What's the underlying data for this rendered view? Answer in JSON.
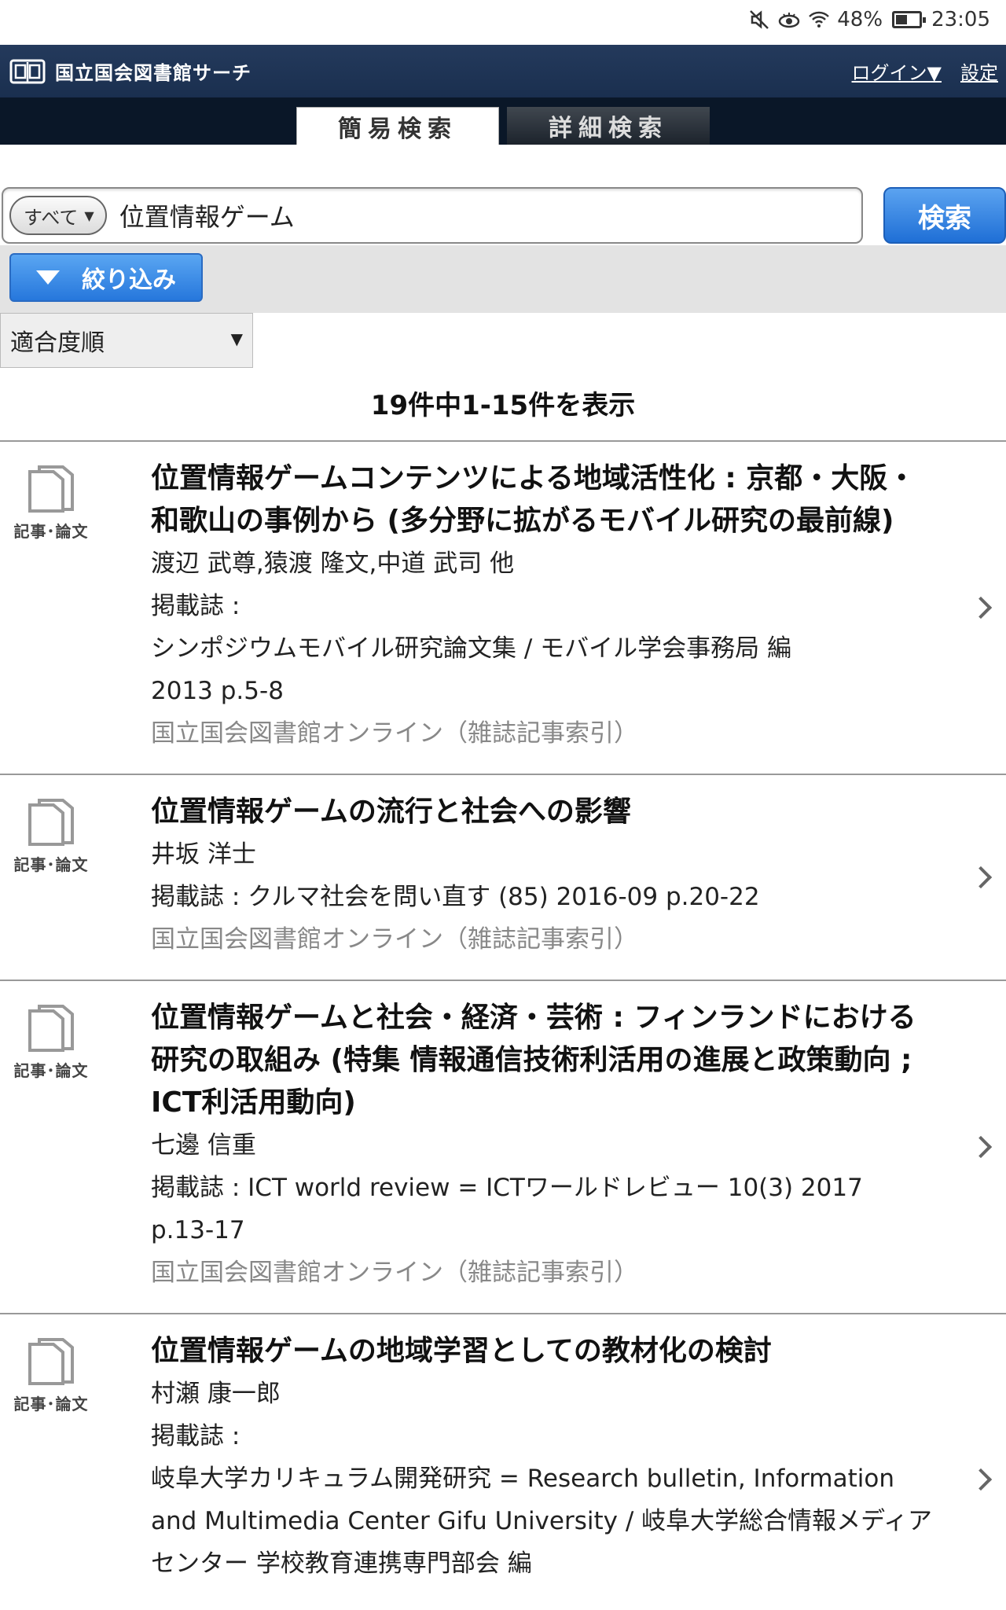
{
  "status": {
    "battery": "48%",
    "time": "23:05"
  },
  "header": {
    "title": "国立国会図書館サーチ",
    "login": "ログイン▼",
    "settings": "設定"
  },
  "tabs": {
    "simple": "簡易検索",
    "advanced": "詳細検索"
  },
  "search": {
    "scope": "すべて",
    "query": "位置情報ゲーム",
    "button": "検索"
  },
  "filter": {
    "label": "絞り込み"
  },
  "sort": {
    "selected": "適合度順"
  },
  "results_count": "19件中1-15件を表示",
  "results": [
    {
      "type_label": "記事･論文",
      "title": "位置情報ゲームコンテンツによる地域活性化 : 京都・大阪・和歌山の事例から (多分野に拡がるモバイル研究の最前線)",
      "authors": "渡辺 武尊,猿渡 隆文,中道 武司 他",
      "journal_label": "掲載誌 :",
      "journal": "シンポジウムモバイル研究論文集 / モバイル学会事務局 編",
      "details": "2013  p.5-8",
      "source": "国立国会図書館オンライン（雑誌記事索引）"
    },
    {
      "type_label": "記事･論文",
      "title": "位置情報ゲームの流行と社会への影響",
      "authors": "井坂 洋士",
      "journal_line": "掲載誌 : クルマ社会を問い直す  (85)  2016-09  p.20-22",
      "source": "国立国会図書館オンライン（雑誌記事索引）"
    },
    {
      "type_label": "記事･論文",
      "title": "位置情報ゲームと社会・経済・芸術 : フィンランドにおける研究の取組み (特集 情報通信技術利活用の進展と政策動向 ; ICT利活用動向)",
      "authors": "七邊 信重",
      "journal_line": "掲載誌 : ICT world review = ICTワールドレビュー  10(3)  2017",
      "details": "p.13-17",
      "source": "国立国会図書館オンライン（雑誌記事索引）"
    },
    {
      "type_label": "記事･論文",
      "title": "位置情報ゲームの地域学習としての教材化の検討",
      "authors": "村瀬 康一郎",
      "journal_label": "掲載誌 :",
      "journal": "岐阜大学カリキュラム開発研究 = Research bulletin, Information and Multimedia Center Gifu University / 岐阜大学総合情報メディアセンター 学校教育連携専門部会 編"
    }
  ]
}
